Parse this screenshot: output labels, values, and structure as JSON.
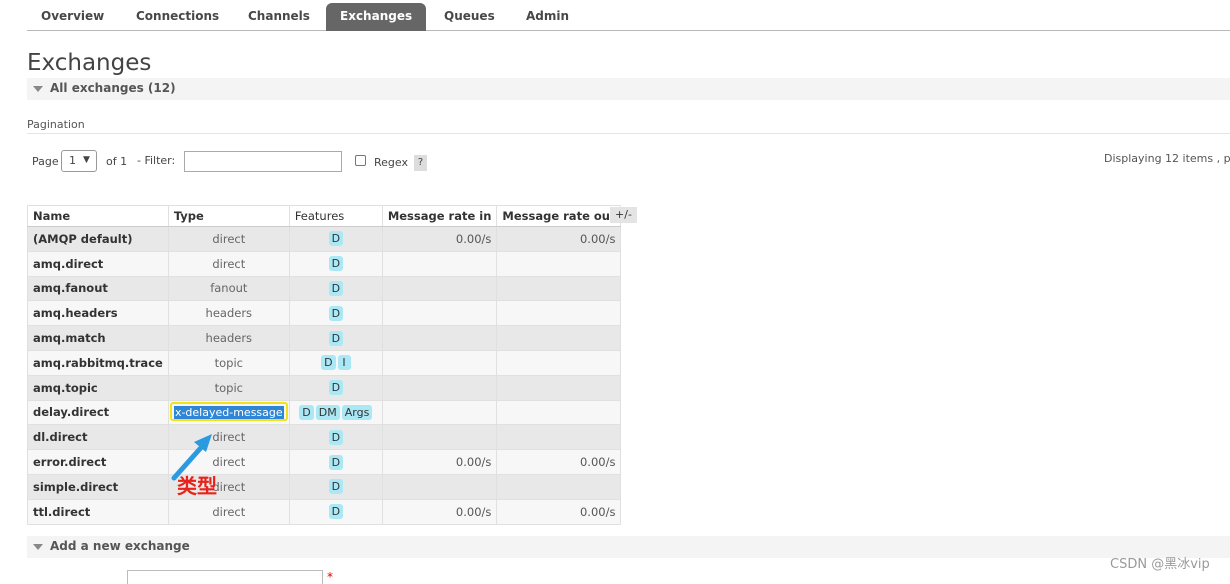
{
  "nav": {
    "tabs": [
      {
        "label": "Overview",
        "active": false
      },
      {
        "label": "Connections",
        "active": false
      },
      {
        "label": "Channels",
        "active": false
      },
      {
        "label": "Exchanges",
        "active": true
      },
      {
        "label": "Queues",
        "active": false
      },
      {
        "label": "Admin",
        "active": false
      }
    ]
  },
  "page": {
    "title": "Exchanges",
    "section_all": "All exchanges (12)",
    "section_add": "Add a new exchange"
  },
  "pagination": {
    "heading": "Pagination",
    "page_label": "Page",
    "page_value": "1",
    "of_label": "of 1",
    "filter_label": "- Filter:",
    "filter_value": "",
    "regex_label": "Regex",
    "help": "?",
    "displaying": "Displaying 12 items , p"
  },
  "table": {
    "columns": [
      "Name",
      "Type",
      "Features",
      "Message rate in",
      "Message rate out"
    ],
    "toggle": "+/-",
    "rows": [
      {
        "name": "(AMQP default)",
        "type": "direct",
        "features": [
          "D"
        ],
        "rate_in": "0.00/s",
        "rate_out": "0.00/s"
      },
      {
        "name": "amq.direct",
        "type": "direct",
        "features": [
          "D"
        ],
        "rate_in": "",
        "rate_out": ""
      },
      {
        "name": "amq.fanout",
        "type": "fanout",
        "features": [
          "D"
        ],
        "rate_in": "",
        "rate_out": ""
      },
      {
        "name": "amq.headers",
        "type": "headers",
        "features": [
          "D"
        ],
        "rate_in": "",
        "rate_out": ""
      },
      {
        "name": "amq.match",
        "type": "headers",
        "features": [
          "D"
        ],
        "rate_in": "",
        "rate_out": ""
      },
      {
        "name": "amq.rabbitmq.trace",
        "type": "topic",
        "features": [
          "D",
          "I"
        ],
        "rate_in": "",
        "rate_out": ""
      },
      {
        "name": "amq.topic",
        "type": "topic",
        "features": [
          "D"
        ],
        "rate_in": "",
        "rate_out": ""
      },
      {
        "name": "delay.direct",
        "type": "x-delayed-message",
        "features": [
          "D",
          "DM",
          "Args"
        ],
        "rate_in": "",
        "rate_out": "",
        "highlighted": true
      },
      {
        "name": "dl.direct",
        "type": "direct",
        "features": [
          "D"
        ],
        "rate_in": "",
        "rate_out": ""
      },
      {
        "name": "error.direct",
        "type": "direct",
        "features": [
          "D"
        ],
        "rate_in": "0.00/s",
        "rate_out": "0.00/s"
      },
      {
        "name": "simple.direct",
        "type": "direct",
        "features": [
          "D"
        ],
        "rate_in": "",
        "rate_out": ""
      },
      {
        "name": "ttl.direct",
        "type": "direct",
        "features": [
          "D"
        ],
        "rate_in": "0.00/s",
        "rate_out": "0.00/s"
      }
    ]
  },
  "annotation": {
    "text": "类型",
    "color": "#e8231b",
    "arrow_color": "#2a9be0"
  },
  "form": {
    "required_mark": "*"
  },
  "watermark": "CSDN @黑冰vip"
}
